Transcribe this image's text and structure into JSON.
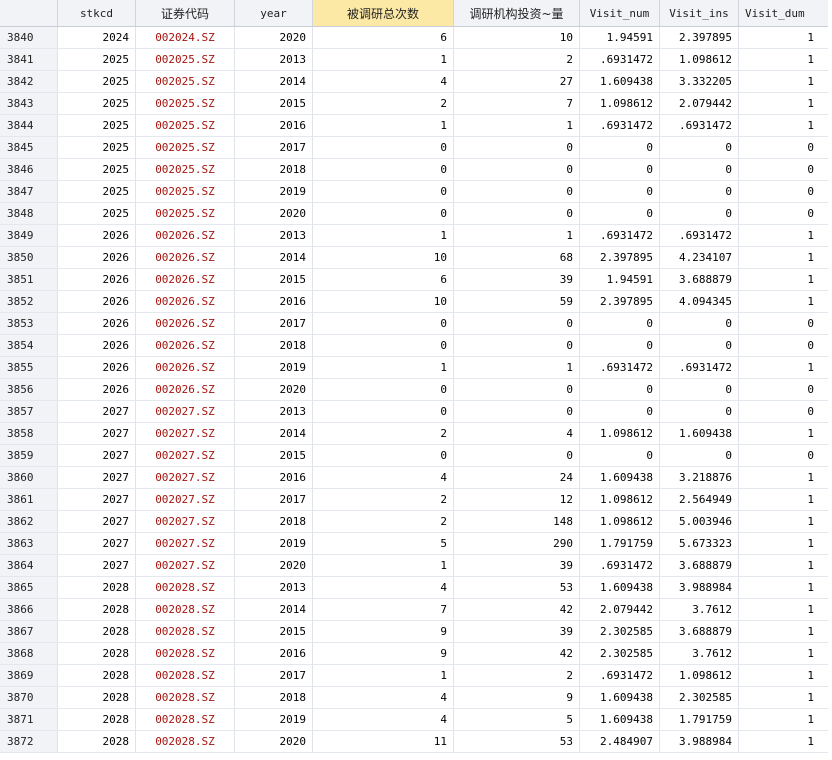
{
  "columns": [
    {
      "key": "idx",
      "label": ""
    },
    {
      "key": "stkcd",
      "label": "stkcd"
    },
    {
      "key": "code",
      "label": "证券代码"
    },
    {
      "key": "year",
      "label": "year"
    },
    {
      "key": "visit",
      "label": "被调研总次数"
    },
    {
      "key": "inv",
      "label": "调研机构投资~量"
    },
    {
      "key": "num",
      "label": "Visit_num"
    },
    {
      "key": "ins",
      "label": "Visit_ins"
    },
    {
      "key": "dum",
      "label": "Visit_dum"
    }
  ],
  "selected_column": "visit",
  "colors": {
    "code_text": "#a5140f",
    "selected_header": "#fde9a6",
    "header_bg": "#f1f3f7"
  },
  "rows": [
    [
      "3840",
      "2024",
      "002024.SZ",
      "2020",
      "6",
      "10",
      "1.94591",
      "2.397895",
      "1"
    ],
    [
      "3841",
      "2025",
      "002025.SZ",
      "2013",
      "1",
      "2",
      ".6931472",
      "1.098612",
      "1"
    ],
    [
      "3842",
      "2025",
      "002025.SZ",
      "2014",
      "4",
      "27",
      "1.609438",
      "3.332205",
      "1"
    ],
    [
      "3843",
      "2025",
      "002025.SZ",
      "2015",
      "2",
      "7",
      "1.098612",
      "2.079442",
      "1"
    ],
    [
      "3844",
      "2025",
      "002025.SZ",
      "2016",
      "1",
      "1",
      ".6931472",
      ".6931472",
      "1"
    ],
    [
      "3845",
      "2025",
      "002025.SZ",
      "2017",
      "0",
      "0",
      "0",
      "0",
      "0"
    ],
    [
      "3846",
      "2025",
      "002025.SZ",
      "2018",
      "0",
      "0",
      "0",
      "0",
      "0"
    ],
    [
      "3847",
      "2025",
      "002025.SZ",
      "2019",
      "0",
      "0",
      "0",
      "0",
      "0"
    ],
    [
      "3848",
      "2025",
      "002025.SZ",
      "2020",
      "0",
      "0",
      "0",
      "0",
      "0"
    ],
    [
      "3849",
      "2026",
      "002026.SZ",
      "2013",
      "1",
      "1",
      ".6931472",
      ".6931472",
      "1"
    ],
    [
      "3850",
      "2026",
      "002026.SZ",
      "2014",
      "10",
      "68",
      "2.397895",
      "4.234107",
      "1"
    ],
    [
      "3851",
      "2026",
      "002026.SZ",
      "2015",
      "6",
      "39",
      "1.94591",
      "3.688879",
      "1"
    ],
    [
      "3852",
      "2026",
      "002026.SZ",
      "2016",
      "10",
      "59",
      "2.397895",
      "4.094345",
      "1"
    ],
    [
      "3853",
      "2026",
      "002026.SZ",
      "2017",
      "0",
      "0",
      "0",
      "0",
      "0"
    ],
    [
      "3854",
      "2026",
      "002026.SZ",
      "2018",
      "0",
      "0",
      "0",
      "0",
      "0"
    ],
    [
      "3855",
      "2026",
      "002026.SZ",
      "2019",
      "1",
      "1",
      ".6931472",
      ".6931472",
      "1"
    ],
    [
      "3856",
      "2026",
      "002026.SZ",
      "2020",
      "0",
      "0",
      "0",
      "0",
      "0"
    ],
    [
      "3857",
      "2027",
      "002027.SZ",
      "2013",
      "0",
      "0",
      "0",
      "0",
      "0"
    ],
    [
      "3858",
      "2027",
      "002027.SZ",
      "2014",
      "2",
      "4",
      "1.098612",
      "1.609438",
      "1"
    ],
    [
      "3859",
      "2027",
      "002027.SZ",
      "2015",
      "0",
      "0",
      "0",
      "0",
      "0"
    ],
    [
      "3860",
      "2027",
      "002027.SZ",
      "2016",
      "4",
      "24",
      "1.609438",
      "3.218876",
      "1"
    ],
    [
      "3861",
      "2027",
      "002027.SZ",
      "2017",
      "2",
      "12",
      "1.098612",
      "2.564949",
      "1"
    ],
    [
      "3862",
      "2027",
      "002027.SZ",
      "2018",
      "2",
      "148",
      "1.098612",
      "5.003946",
      "1"
    ],
    [
      "3863",
      "2027",
      "002027.SZ",
      "2019",
      "5",
      "290",
      "1.791759",
      "5.673323",
      "1"
    ],
    [
      "3864",
      "2027",
      "002027.SZ",
      "2020",
      "1",
      "39",
      ".6931472",
      "3.688879",
      "1"
    ],
    [
      "3865",
      "2028",
      "002028.SZ",
      "2013",
      "4",
      "53",
      "1.609438",
      "3.988984",
      "1"
    ],
    [
      "3866",
      "2028",
      "002028.SZ",
      "2014",
      "7",
      "42",
      "2.079442",
      "3.7612",
      "1"
    ],
    [
      "3867",
      "2028",
      "002028.SZ",
      "2015",
      "9",
      "39",
      "2.302585",
      "3.688879",
      "1"
    ],
    [
      "3868",
      "2028",
      "002028.SZ",
      "2016",
      "9",
      "42",
      "2.302585",
      "3.7612",
      "1"
    ],
    [
      "3869",
      "2028",
      "002028.SZ",
      "2017",
      "1",
      "2",
      ".6931472",
      "1.098612",
      "1"
    ],
    [
      "3870",
      "2028",
      "002028.SZ",
      "2018",
      "4",
      "9",
      "1.609438",
      "2.302585",
      "1"
    ],
    [
      "3871",
      "2028",
      "002028.SZ",
      "2019",
      "4",
      "5",
      "1.609438",
      "1.791759",
      "1"
    ],
    [
      "3872",
      "2028",
      "002028.SZ",
      "2020",
      "11",
      "53",
      "2.484907",
      "3.988984",
      "1"
    ]
  ]
}
